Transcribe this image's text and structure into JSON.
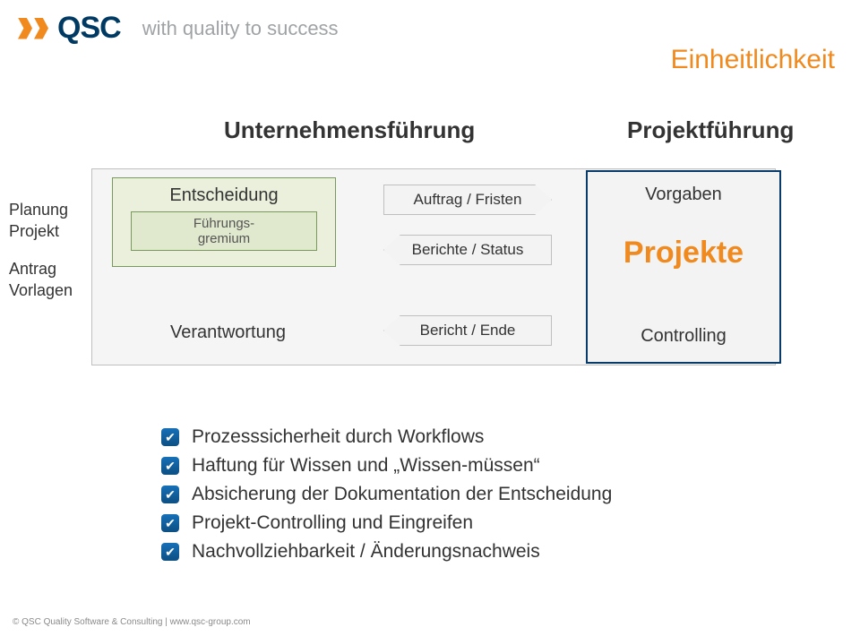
{
  "brand": {
    "name": "QSC",
    "tagline": "with quality to success"
  },
  "page_title": "Einheitlichkeit",
  "diagram": {
    "header_left": "Unternehmensführung",
    "header_right": "Projektführung",
    "left_labels": {
      "planung": "Planung",
      "projekt": "Projekt",
      "antrag": "Antrag",
      "vorlagen": "Vorlagen"
    },
    "decision": {
      "title": "Entscheidung",
      "sub": "Führungs-\ngremium"
    },
    "verantwortung": "Verantwortung",
    "arrows": {
      "a1": "Auftrag / Fristen",
      "a2": "Berichte / Status",
      "a3": "Bericht / Ende"
    },
    "project_box": {
      "vorgaben": "Vorgaben",
      "projekte": "Projekte",
      "controlling": "Controlling"
    }
  },
  "bullets": [
    "Prozesssicherheit durch Workflows",
    "Haftung für Wissen und „Wissen-müssen“",
    "Absicherung der Dokumentation der Entscheidung",
    "Projekt-Controlling und Eingreifen",
    "Nachvollziehbarkeit / Änderungsnachweis"
  ],
  "footer": "© QSC Quality Software & Consulting  |  www.qsc-group.com"
}
